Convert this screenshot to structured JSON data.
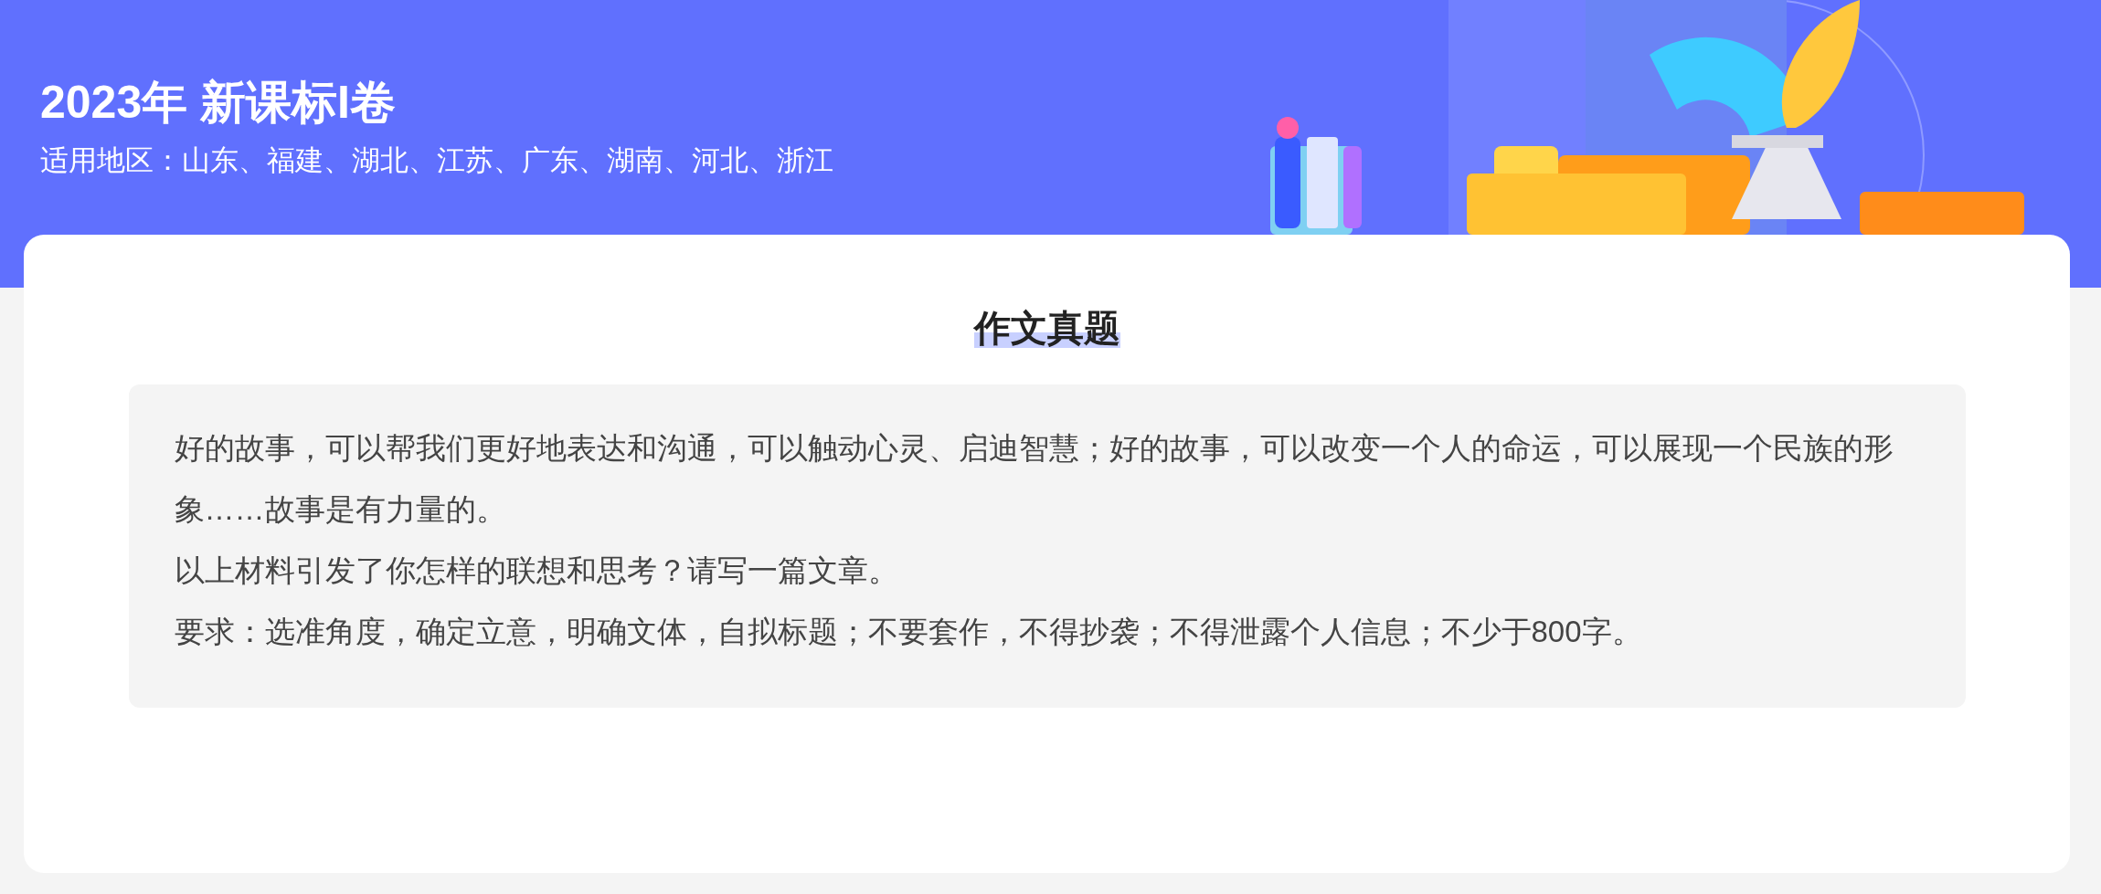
{
  "header": {
    "title": "2023年 新课标I卷",
    "subtitle": "适用地区：山东、福建、湖北、江苏、广东、湖南、河北、浙江"
  },
  "card": {
    "heading": "作文真题",
    "paragraphs": [
      "好的故事，可以帮我们更好地表达和沟通，可以触动心灵、启迪智慧；好的故事，可以改变一个人的命运，可以展现一个民族的形象……故事是有力量的。",
      "以上材料引发了你怎样的联想和思考？请写一篇文章。",
      "要求：选准角度，确定立意，明确文体，自拟标题；不要套作，不得抄袭；不得泄露个人信息；不少于800字。"
    ]
  }
}
